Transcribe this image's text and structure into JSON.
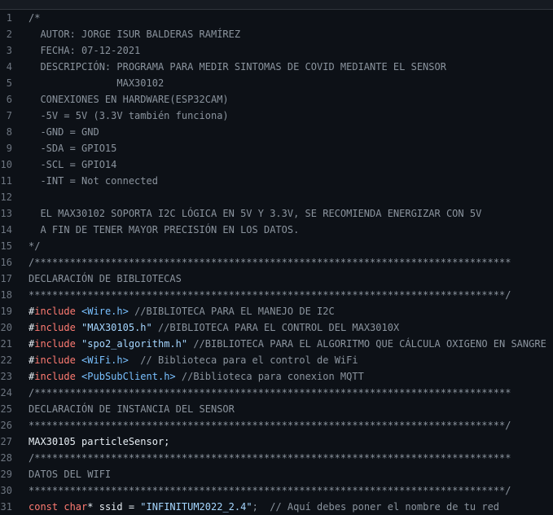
{
  "editor": {
    "lines": [
      {
        "n": "1",
        "segs": [
          {
            "t": "/*",
            "c": "c"
          }
        ]
      },
      {
        "n": "2",
        "segs": [
          {
            "t": "  AUTOR: JORGE ISUR BALDERAS RAMÍREZ",
            "c": "c"
          }
        ]
      },
      {
        "n": "3",
        "segs": [
          {
            "t": "  FECHA: 07-12-2021",
            "c": "c"
          }
        ]
      },
      {
        "n": "4",
        "segs": [
          {
            "t": "  DESCRIPCIÓN: PROGRAMA PARA MEDIR SINTOMAS DE COVID MEDIANTE EL SENSOR",
            "c": "c"
          }
        ]
      },
      {
        "n": "5",
        "segs": [
          {
            "t": "               MAX30102",
            "c": "c"
          }
        ]
      },
      {
        "n": "6",
        "segs": [
          {
            "t": "  CONEXIONES EN HARDWARE(ESP32CAM)",
            "c": "c"
          }
        ]
      },
      {
        "n": "7",
        "segs": [
          {
            "t": "  -5V = 5V (3.3V también funciona)",
            "c": "c"
          }
        ]
      },
      {
        "n": "8",
        "segs": [
          {
            "t": "  -GND = GND",
            "c": "c"
          }
        ]
      },
      {
        "n": "9",
        "segs": [
          {
            "t": "  -SDA = GPIO15",
            "c": "c"
          }
        ]
      },
      {
        "n": "10",
        "segs": [
          {
            "t": "  -SCL = GPIO14",
            "c": "c"
          }
        ]
      },
      {
        "n": "11",
        "segs": [
          {
            "t": "  -INT = Not connected",
            "c": "c"
          }
        ]
      },
      {
        "n": "12",
        "segs": [
          {
            "t": "",
            "c": "c"
          }
        ]
      },
      {
        "n": "13",
        "segs": [
          {
            "t": "  EL MAX30102 SOPORTA I2C LÓGICA EN 5V Y 3.3V, SE RECOMIENDA ENERGIZAR CON 5V",
            "c": "c"
          }
        ]
      },
      {
        "n": "14",
        "segs": [
          {
            "t": "  A FIN DE TENER MAYOR PRECISIÓN EN LOS DATOS.",
            "c": "c"
          }
        ]
      },
      {
        "n": "15",
        "segs": [
          {
            "t": "*/",
            "c": "c"
          }
        ]
      },
      {
        "n": "16",
        "segs": [
          {
            "t": "/*********************************************************************************",
            "c": "c"
          }
        ]
      },
      {
        "n": "17",
        "segs": [
          {
            "t": "DECLARACIÓN DE BIBLIOTECAS",
            "c": "c"
          }
        ]
      },
      {
        "n": "18",
        "segs": [
          {
            "t": "*********************************************************************************/",
            "c": "c"
          }
        ]
      },
      {
        "n": "19",
        "segs": [
          {
            "t": "#",
            "c": "t"
          },
          {
            "t": "include",
            "c": "kw"
          },
          {
            "t": " ",
            "c": "t"
          },
          {
            "t": "<Wire.h>",
            "c": "h"
          },
          {
            "t": " //BIBLIOTECA PARA EL MANEJO DE I2C",
            "c": "c"
          }
        ]
      },
      {
        "n": "20",
        "segs": [
          {
            "t": "#",
            "c": "t"
          },
          {
            "t": "include",
            "c": "kw"
          },
          {
            "t": " ",
            "c": "t"
          },
          {
            "t": "\"MAX30105.h\"",
            "c": "s"
          },
          {
            "t": " //BIBLIOTECA PARA EL CONTROL DEL MAX3010X",
            "c": "c"
          }
        ]
      },
      {
        "n": "21",
        "segs": [
          {
            "t": "#",
            "c": "t"
          },
          {
            "t": "include",
            "c": "kw"
          },
          {
            "t": " ",
            "c": "t"
          },
          {
            "t": "\"spo2_algorithm.h\"",
            "c": "s"
          },
          {
            "t": " //BIBLIOTECA PARA EL ALGORITMO QUE CÁLCULA OXIGENO EN SANGRE",
            "c": "c"
          }
        ]
      },
      {
        "n": "22",
        "segs": [
          {
            "t": "#",
            "c": "t"
          },
          {
            "t": "include",
            "c": "kw"
          },
          {
            "t": " ",
            "c": "t"
          },
          {
            "t": "<WiFi.h>",
            "c": "h"
          },
          {
            "t": "  // Biblioteca para el control de WiFi",
            "c": "c"
          }
        ]
      },
      {
        "n": "23",
        "segs": [
          {
            "t": "#",
            "c": "t"
          },
          {
            "t": "include",
            "c": "kw"
          },
          {
            "t": " ",
            "c": "t"
          },
          {
            "t": "<PubSubClient.h>",
            "c": "h"
          },
          {
            "t": " //Biblioteca para conexion MQTT",
            "c": "c"
          }
        ]
      },
      {
        "n": "24",
        "segs": [
          {
            "t": "/*********************************************************************************",
            "c": "c"
          }
        ]
      },
      {
        "n": "25",
        "segs": [
          {
            "t": "DECLARACIÓN DE INSTANCIA DEL SENSOR",
            "c": "c"
          }
        ]
      },
      {
        "n": "26",
        "segs": [
          {
            "t": "*********************************************************************************/",
            "c": "c"
          }
        ]
      },
      {
        "n": "27",
        "segs": [
          {
            "t": "MAX30105 particleSensor;",
            "c": "t"
          }
        ]
      },
      {
        "n": "28",
        "segs": [
          {
            "t": "/*********************************************************************************",
            "c": "c"
          }
        ]
      },
      {
        "n": "29",
        "segs": [
          {
            "t": "DATOS DEL WIFI",
            "c": "c"
          }
        ]
      },
      {
        "n": "30",
        "segs": [
          {
            "t": "*********************************************************************************/",
            "c": "c"
          }
        ]
      },
      {
        "n": "31",
        "segs": [
          {
            "t": "const",
            "c": "kw"
          },
          {
            "t": " ",
            "c": "t"
          },
          {
            "t": "char",
            "c": "kw"
          },
          {
            "t": "* ssid = ",
            "c": "t"
          },
          {
            "t": "\"INFINITUM2022_2.4\"",
            "c": "s"
          },
          {
            "t": ";  // Aquí debes poner el nombre de tu red",
            "c": "c"
          }
        ]
      }
    ]
  }
}
